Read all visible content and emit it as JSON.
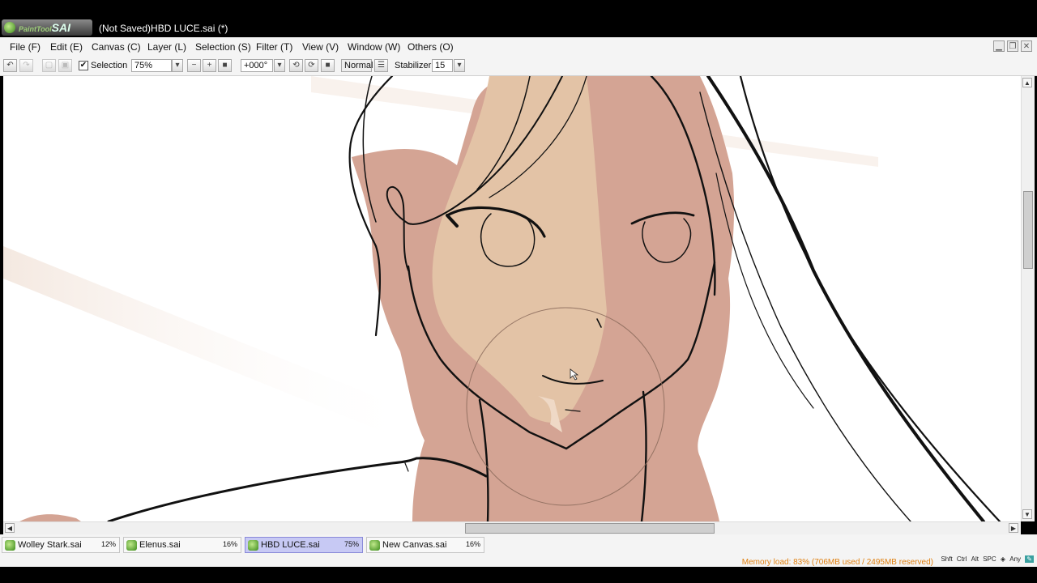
{
  "app": {
    "logo_text": "PaintTool",
    "logo_brand": "SAI",
    "window_title": "(Not Saved)HBD LUCE.sai (*)"
  },
  "menu": [
    "File (F)",
    "Edit (E)",
    "Canvas (C)",
    "Layer (L)",
    "Selection (S)",
    "Filter (T)",
    "View (V)",
    "Window (W)",
    "Others (O)"
  ],
  "window_controls": {
    "minimize": "▁",
    "restore": "❐",
    "close": "✕"
  },
  "toolbar": {
    "selection_checked": true,
    "selection_label": "Selection",
    "zoom": "75%",
    "rotation": "+000°",
    "blend_mode": "Normal",
    "stabilizer_label": "Stabilizer",
    "stabilizer_value": "15"
  },
  "documents": [
    {
      "name": "Wolley Stark.sai",
      "zoom": "12%",
      "active": false
    },
    {
      "name": "Elenus.sai",
      "zoom": "16%",
      "active": false
    },
    {
      "name": "HBD LUCE.sai",
      "zoom": "75%",
      "active": true
    },
    {
      "name": "New Canvas.sai",
      "zoom": "16%",
      "active": false
    }
  ],
  "status": {
    "memory": "Memory load: 83% (706MB used / 2495MB reserved)",
    "modifiers": [
      "Shft",
      "Ctrl",
      "Alt",
      "SPC",
      "◈",
      "Any",
      "✎"
    ]
  },
  "colors": {
    "skin_light": "#e3c3a6",
    "skin_shadow": "#d4a494",
    "memory_text": "#e08010",
    "active_tab": "#c7c9f4"
  }
}
